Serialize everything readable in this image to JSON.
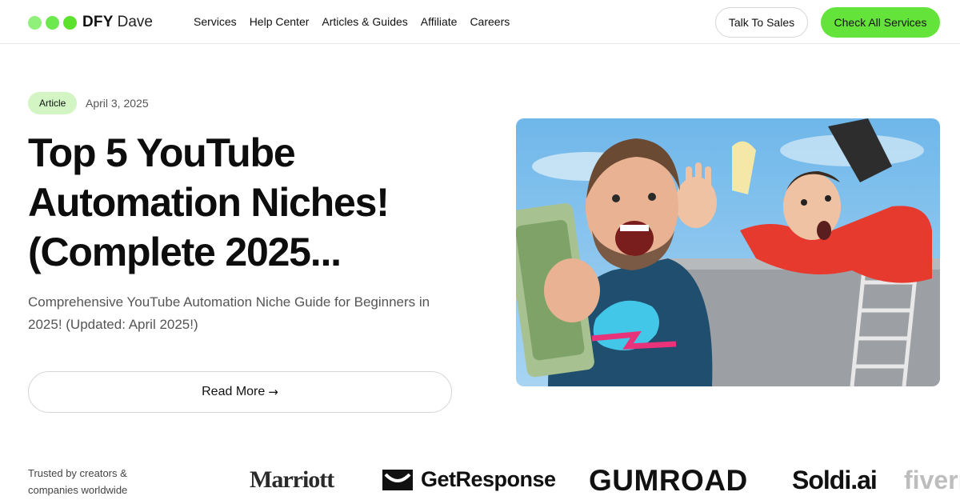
{
  "colors": {
    "brand_green": "#5ce12d",
    "badge_green": "#d3f5c4",
    "cta_green": "#64e43b"
  },
  "header": {
    "logo_bold": "DFY",
    "logo_light": "Dave",
    "nav": [
      "Services",
      "Help Center",
      "Articles & Guides",
      "Affiliate",
      "Careers"
    ],
    "talk_to_sales": "Talk To Sales",
    "check_services": "Check All Services"
  },
  "article": {
    "badge": "Article",
    "date": "April 3, 2025",
    "title": "Top 5 YouTube Automation Niches! (Complete 2025...",
    "subtitle": "Comprehensive YouTube Automation Niche Guide for Beginners in 2025! (Updated: April 2025!)",
    "read_more": "Read More",
    "read_more_icon": "arrow-right-icon"
  },
  "trusted": {
    "text": "Trusted by creators & companies worldwide",
    "logos": [
      "Marriott",
      "GetResponse",
      "GUMROAD",
      "Soldi.ai",
      "fiverr"
    ]
  }
}
